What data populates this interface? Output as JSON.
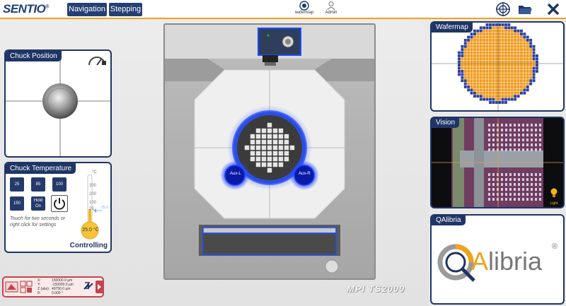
{
  "header": {
    "logo": "SENTIO",
    "logo_mark": "®",
    "tabs": [
      {
        "label": "Navigation"
      },
      {
        "label": "Stepping"
      }
    ],
    "center_icons": [
      {
        "label": "wafermap",
        "icon": "wafermap-icon"
      },
      {
        "label": "Admin",
        "icon": "user-icon"
      }
    ],
    "accent_color": "#f0a31b"
  },
  "chuck_position": {
    "title": "Chuck Position"
  },
  "chuck_temperature": {
    "title": "Chuck Temperature",
    "buttons": [
      "25",
      "85",
      "100",
      "150",
      "Hold On"
    ],
    "hint": "Touch for two seconds or right click for settings",
    "scale_ticks": [
      "°C",
      "300",
      "200",
      "100",
      "25"
    ],
    "target": "25.0",
    "current": "25.0 °C",
    "status": "Controlling"
  },
  "machine": {
    "model": "MPI TS2000",
    "aux_left": "Aux-L",
    "aux_right": "Aux-R"
  },
  "coordinates": {
    "rows": [
      {
        "axis": "X:",
        "value": "150000.0 µm"
      },
      {
        "axis": "Y:",
        "value": "-150000.0 µm"
      },
      {
        "axis": "Z (abs):",
        "value": "49750.0 µm"
      },
      {
        "axis": "θ:",
        "value": "0.000 °"
      }
    ]
  },
  "wafermap": {
    "title": "Wafermap",
    "wafer_color": "#f29a1c",
    "edge_color": "#2d3f9c"
  },
  "vision": {
    "title": "Vision",
    "light_label": "Light"
  },
  "qalibria": {
    "title": "QAlibria",
    "logo_q": "Q",
    "logo_a": "A",
    "logo_rest": "libria",
    "logo_mark": "®"
  }
}
